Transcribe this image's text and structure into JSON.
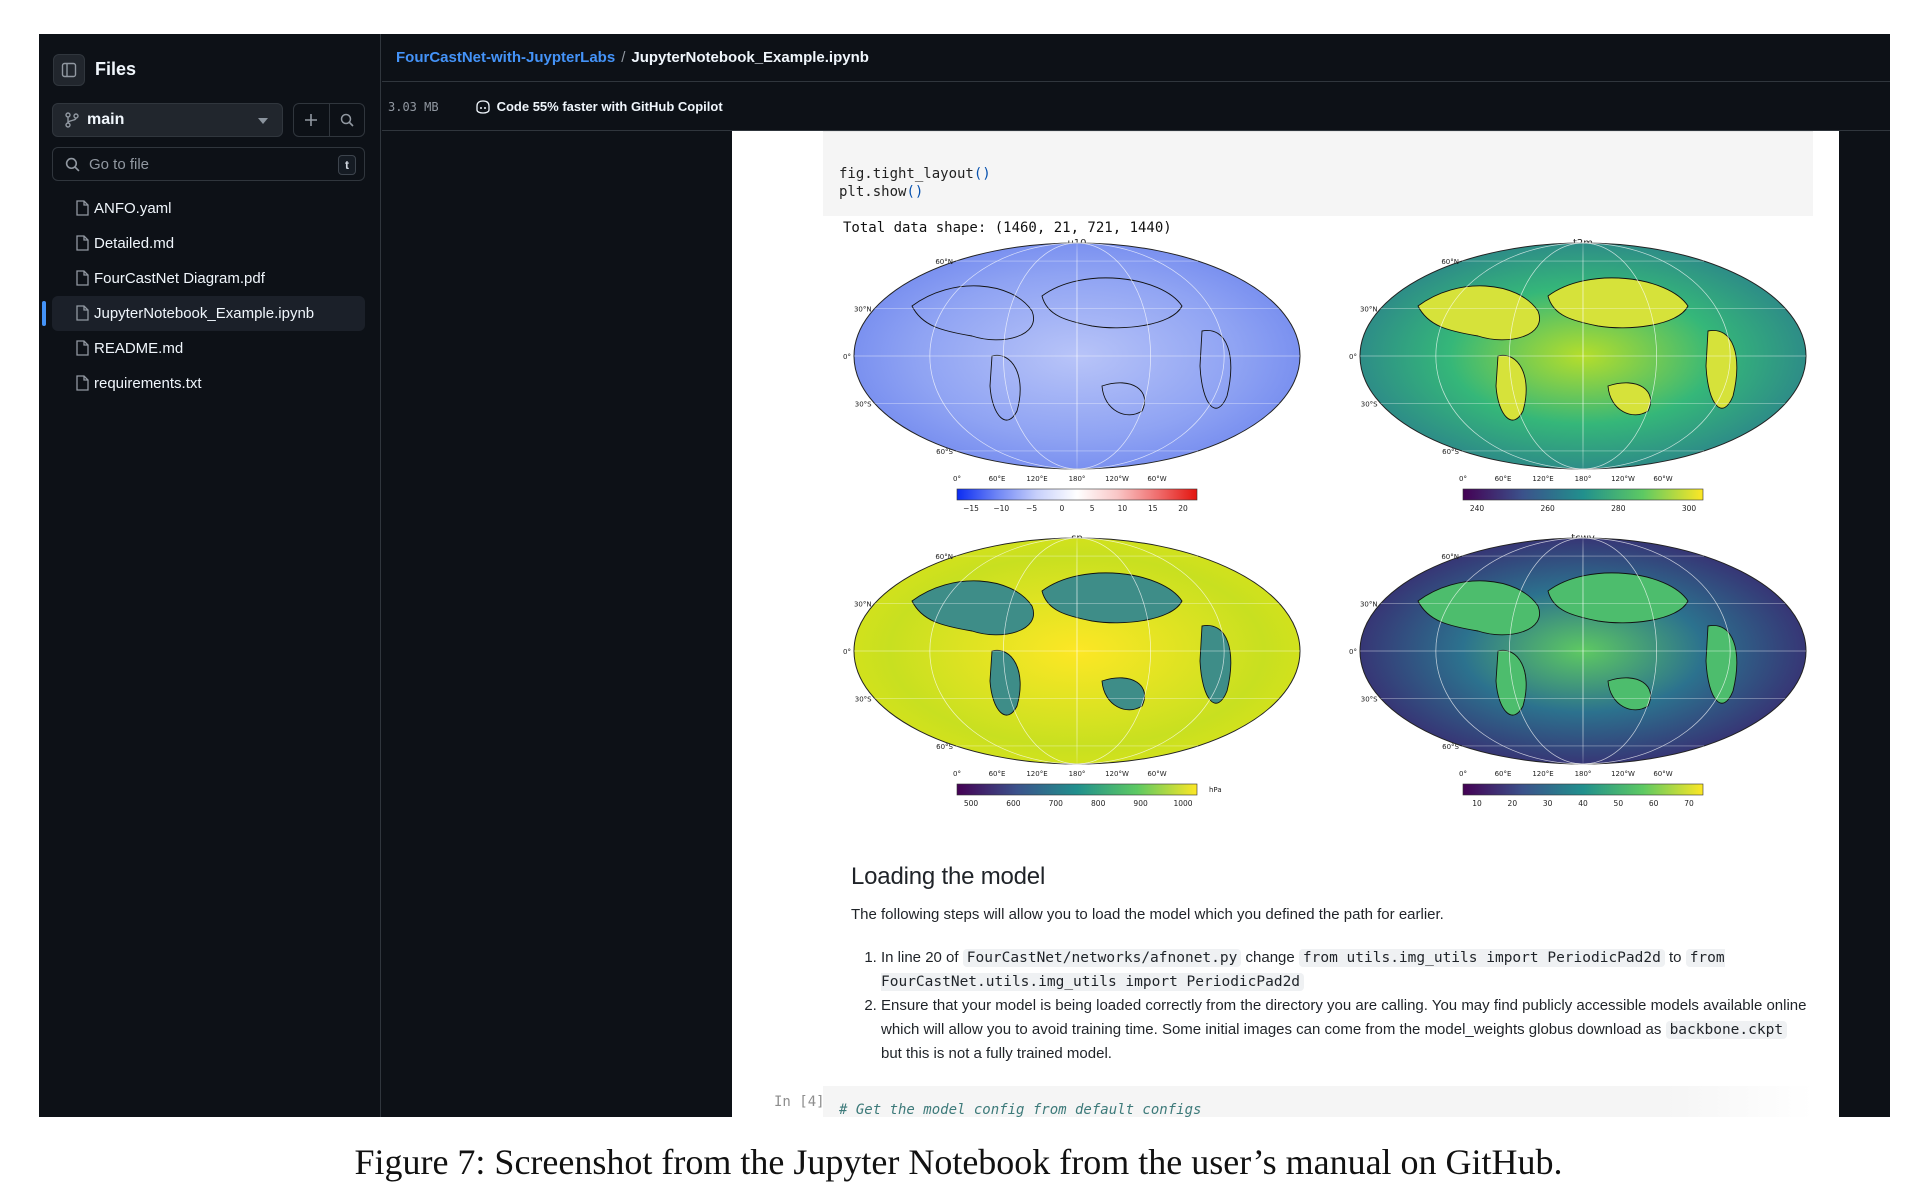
{
  "sidebar": {
    "title": "Files",
    "branch": "main",
    "goto_placeholder": "Go to file",
    "goto_shortcut": "t",
    "files": [
      {
        "name": "ANFO.yaml"
      },
      {
        "name": "Detailed.md"
      },
      {
        "name": "FourCastNet Diagram.pdf"
      },
      {
        "name": "JupyterNotebook_Example.ipynb",
        "active": true
      },
      {
        "name": "README.md"
      },
      {
        "name": "requirements.txt"
      }
    ]
  },
  "header": {
    "repo": "FourCastNet-with-JuypterLabs",
    "separator": "/",
    "file": "JupyterNotebook_Example.ipynb",
    "size": "3.03 MB",
    "copilot": "Code 55% faster with GitHub Copilot"
  },
  "notebook": {
    "code_line1": "fig.tight_layout",
    "code_line2": "plt.show",
    "code_parens": "()",
    "output": "Total data shape: (1460, 21, 721, 1440)",
    "maps": [
      {
        "title": "u10",
        "colormap": "coolwarm",
        "ticks": [
          "−15",
          "−10",
          "−5",
          "0",
          "5",
          "10",
          "15",
          "20"
        ],
        "unit": ""
      },
      {
        "title": "t2m",
        "colormap": "viridis",
        "ticks": [
          "240",
          "260",
          "280",
          "300"
        ],
        "unit": ""
      },
      {
        "title": "sp",
        "colormap": "viridis",
        "ticks": [
          "500",
          "600",
          "700",
          "800",
          "900",
          "1000"
        ],
        "unit": "hPa"
      },
      {
        "title": "tcwv",
        "colormap": "viridis",
        "ticks": [
          "10",
          "20",
          "30",
          "40",
          "50",
          "60",
          "70"
        ],
        "unit": ""
      }
    ],
    "lat_labels": [
      "60°N",
      "30°N",
      "0°",
      "30°S",
      "60°S"
    ],
    "lon_labels": [
      "0°",
      "60°E",
      "120°E",
      "180°",
      "120°W",
      "60°W"
    ],
    "heading": "Loading the model",
    "intro": "The following steps will allow you to load the model which you defined the path for earlier.",
    "step1": {
      "pre": "In line 20 of ",
      "code1": "FourCastNet/networks/afnonet.py",
      "mid": " change ",
      "code2": "from utils.img_utils import PeriodicPad2d",
      "mid2": " to ",
      "code3": "from FourCastNet.utils.img_utils import PeriodicPad2d"
    },
    "step2": {
      "pre": "Ensure that your model is being loaded correctly from the directory you are calling. You may find publicly accessible models available online which will allow you to avoid training time. Some initial images can come from the model_weights globus download as ",
      "code": "backbone.ckpt",
      "post": " but this is not a fully trained model."
    },
    "next_prompt": "In [4]:",
    "next_code": "# Get the model config from default configs"
  },
  "caption": "Figure 7: Screenshot from the Jupyter Notebook from the user’s manual on GitHub.",
  "colors": {
    "bg": "#0d1117",
    "border": "#30363d",
    "link": "#4493f8",
    "text": "#f0f6fc",
    "muted": "#9198a1"
  }
}
